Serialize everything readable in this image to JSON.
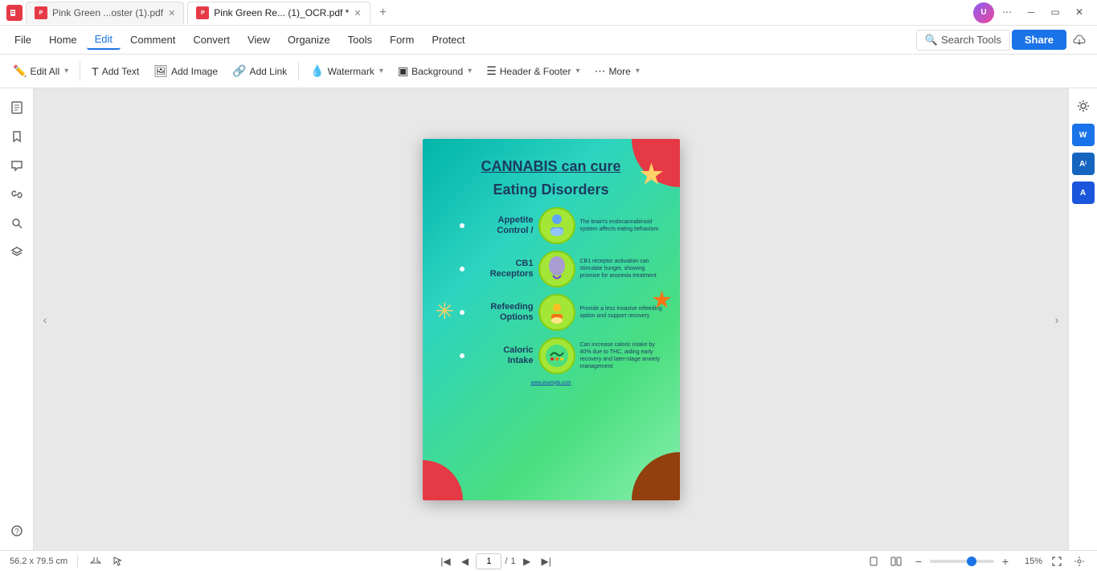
{
  "titleBar": {
    "tabs": [
      {
        "label": "Pink Green ...oster (1).pdf",
        "active": false
      },
      {
        "label": "Pink Green Re... (1)_OCR.pdf *",
        "active": true
      }
    ],
    "addTab": "+"
  },
  "menuBar": {
    "items": [
      "File",
      "Home",
      "Edit",
      "Comment",
      "Convert",
      "View",
      "Organize",
      "Tools",
      "Form",
      "Protect"
    ],
    "activeItem": "Edit",
    "searchTools": "Search Tools",
    "share": "Share"
  },
  "toolbar": {
    "editAll": "Edit All",
    "addText": "Add Text",
    "addImage": "Add Image",
    "addLink": "Add Link",
    "watermark": "Watermark",
    "background": "Background",
    "headerFooter": "Header & Footer",
    "more": "More"
  },
  "sidebar": {
    "icons": [
      "page",
      "bookmark",
      "comment",
      "link",
      "search",
      "layers"
    ]
  },
  "pdf": {
    "title": "CANNABIS can cure",
    "subtitle": "Eating Disorders",
    "sections": [
      {
        "label": "Appetite\nControl /",
        "desc": "The brain's endocannabinoid system affects eating behaviors"
      },
      {
        "label": "CB1\nReceptors",
        "desc": "CB1 receptor activation can stimulate hunger, showing promise for anorexia treatment"
      },
      {
        "label": "Refeeding\nOptions",
        "desc": "Provide a less invasive refeeding option and support recovery"
      },
      {
        "label": "Caloric\nIntake",
        "desc": "Can increase caloric intake by 40% due to THC, aiding early recovery and later-stage anxiety management"
      }
    ],
    "url": "www.example.com"
  },
  "statusBar": {
    "dimensions": "56.2 x 79.5 cm",
    "tools": [
      "hand",
      "arrow"
    ],
    "pageFirst": "«",
    "pagePrev": "‹",
    "pageNum": "1",
    "pageSep": "/",
    "pageTotal": "1",
    "pageNext": "›",
    "pageLast": "»",
    "viewModes": [
      "single",
      "double"
    ],
    "zoomMinus": "−",
    "zoomPlus": "+",
    "zoomLevel": "15%",
    "fullscreen": "⛶"
  },
  "rightSidebar": {
    "settingsIcon": "⚙",
    "wordIcon": "W",
    "aiIcon": "A1",
    "wordBlueIcon": "A"
  }
}
